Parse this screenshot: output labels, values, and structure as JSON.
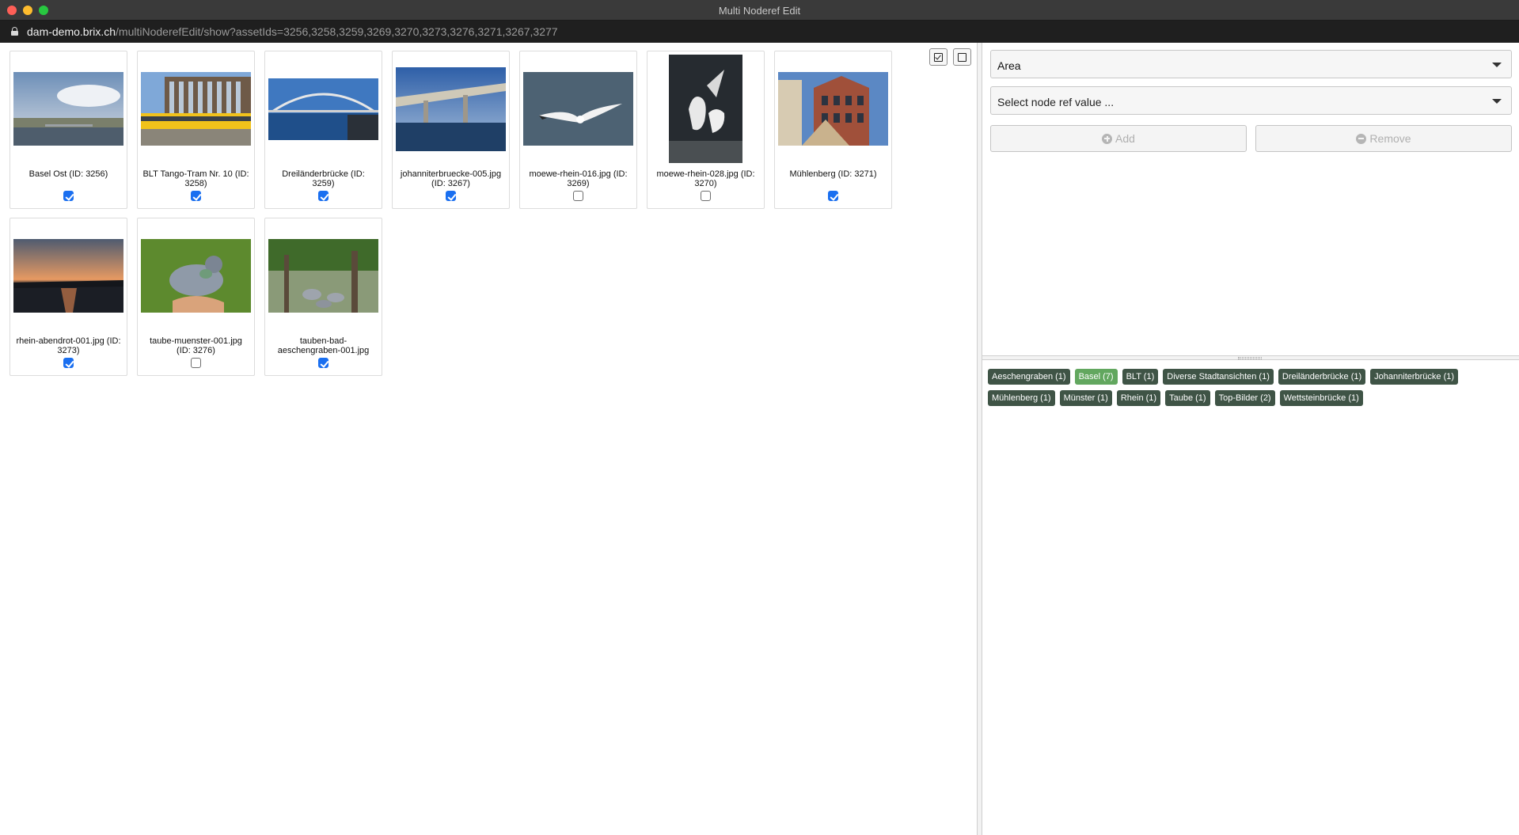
{
  "window": {
    "title": "Multi Noderef Edit"
  },
  "address_bar": {
    "host": "dam-demo.brix.ch",
    "path": "/multiNoderefEdit/show?assetIds=3256,3258,3259,3269,3270,3273,3276,3271,3267,3277"
  },
  "toolbar": {
    "check_all_icon": "checked-square-icon",
    "uncheck_all_icon": "empty-square-icon"
  },
  "assets": [
    {
      "caption": "Basel Ost (ID: 3256)",
      "checked": true,
      "thumb": "city-river"
    },
    {
      "caption": "BLT Tango-Tram Nr. 10 (ID: 3258)",
      "checked": true,
      "thumb": "tram"
    },
    {
      "caption": "Dreiländerbrücke (ID: 3259)",
      "checked": true,
      "thumb": "arch-bridge"
    },
    {
      "caption": "johanniterbruecke-005.jpg (ID: 3267)",
      "checked": true,
      "thumb": "bridge"
    },
    {
      "caption": "moewe-rhein-016.jpg (ID: 3269)",
      "checked": false,
      "thumb": "gull-flying"
    },
    {
      "caption": "moewe-rhein-028.jpg (ID: 3270)",
      "checked": false,
      "thumb": "gulls-portrait"
    },
    {
      "caption": "Mühlenberg (ID: 3271)",
      "checked": true,
      "thumb": "old-houses"
    },
    {
      "caption": "rhein-abendrot-001.jpg (ID: 3273)",
      "checked": true,
      "thumb": "sunset-river"
    },
    {
      "caption": "taube-muenster-001.jpg (ID: 3276)",
      "checked": false,
      "thumb": "pigeon"
    },
    {
      "caption": "tauben-bad-aeschengraben-001.jpg",
      "checked": true,
      "thumb": "pigeons-park"
    }
  ],
  "editor": {
    "field_select": "Area",
    "value_placeholder": "Select node ref value ...",
    "add_label": "Add",
    "remove_label": "Remove"
  },
  "tags": [
    {
      "label": "Aeschengraben (1)",
      "active": false
    },
    {
      "label": "Basel (7)",
      "active": true
    },
    {
      "label": "BLT (1)",
      "active": false
    },
    {
      "label": "Diverse Stadtansichten (1)",
      "active": false
    },
    {
      "label": "Dreiländerbrücke (1)",
      "active": false
    },
    {
      "label": "Johanniterbrücke (1)",
      "active": false
    },
    {
      "label": "Mühlenberg (1)",
      "active": false
    },
    {
      "label": "Münster (1)",
      "active": false
    },
    {
      "label": "Rhein (1)",
      "active": false
    },
    {
      "label": "Taube (1)",
      "active": false
    },
    {
      "label": "Top-Bilder (2)",
      "active": false
    },
    {
      "label": "Wettsteinbrücke (1)",
      "active": false
    }
  ]
}
